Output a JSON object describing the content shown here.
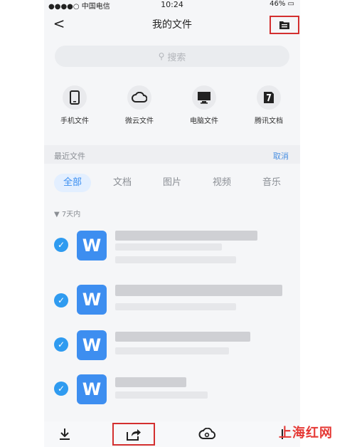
{
  "status": {
    "carrier": "●●●●○ 中国电信 ",
    "time": "10:24",
    "battery": "46%"
  },
  "navbar": {
    "back": "<",
    "title": "我的文件"
  },
  "search": {
    "placeholder": "搜索"
  },
  "entries": [
    {
      "label": "手机文件",
      "icon": "phone-icon"
    },
    {
      "label": "微云文件",
      "icon": "cloud-icon"
    },
    {
      "label": "电脑文件",
      "icon": "monitor-icon"
    },
    {
      "label": "腾讯文档",
      "icon": "tencent-doc-icon"
    }
  ],
  "recent": {
    "title": "最近文件",
    "cancel": "取消"
  },
  "tabs": [
    "全部",
    "文档",
    "图片",
    "视频",
    "音乐"
  ],
  "group": {
    "label": "7天内"
  },
  "files": [
    {
      "icon_letter": "W"
    },
    {
      "icon_letter": "W"
    },
    {
      "icon_letter": "W"
    },
    {
      "icon_letter": "W"
    }
  ],
  "watermark": "上海红网",
  "colors": {
    "accent": "#3a8ef0",
    "highlight_border": "#d32f2f",
    "word_icon": "#3d8ef0"
  }
}
